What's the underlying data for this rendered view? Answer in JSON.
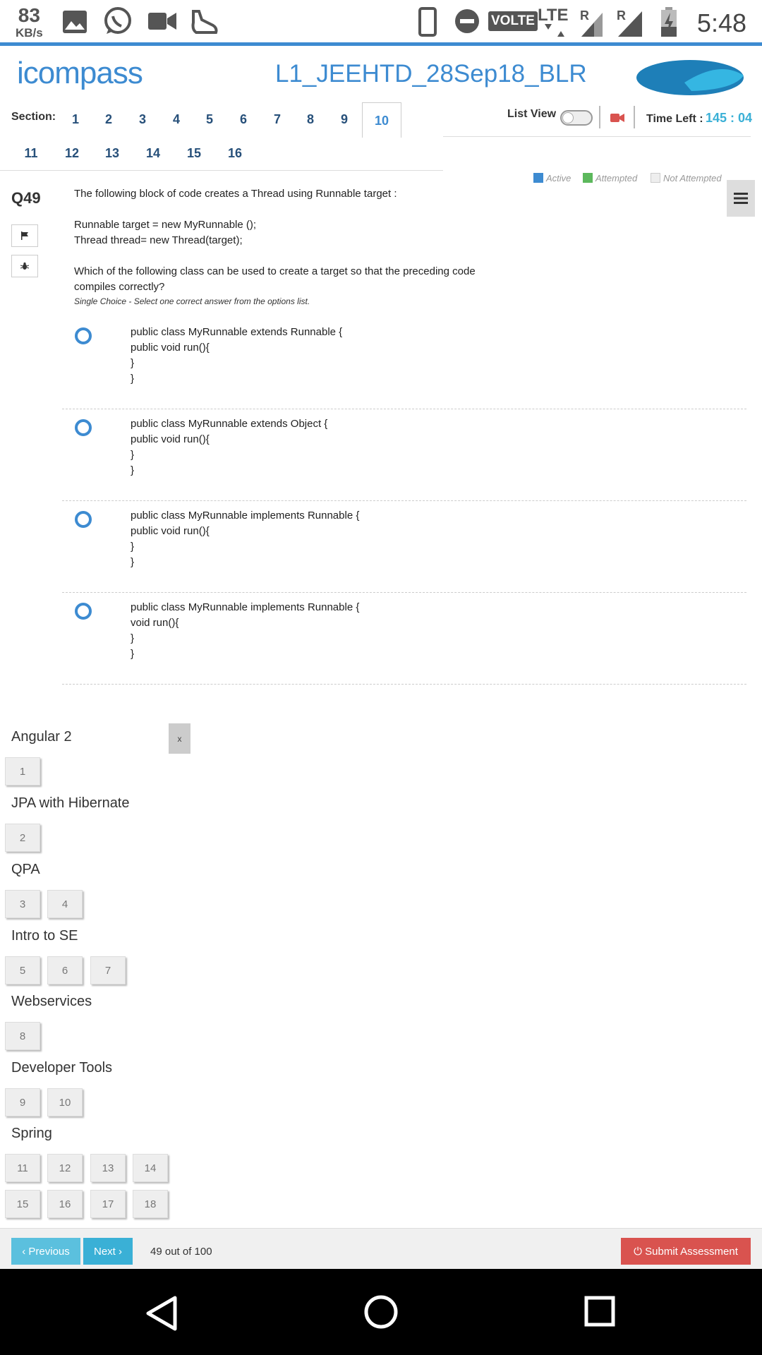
{
  "status_bar": {
    "speed_value": "83",
    "speed_unit": "KB/s",
    "volte": "VOLTE",
    "lte": "LTE",
    "roaming": "R",
    "time": "5:48"
  },
  "header": {
    "logo_text": "icompass",
    "title": "L1_JEEHTD_28Sep18_BLR"
  },
  "sections": {
    "label": "Section:",
    "tabs": [
      "1",
      "2",
      "3",
      "4",
      "5",
      "6",
      "7",
      "8",
      "9",
      "10",
      "11",
      "12",
      "13",
      "14",
      "15",
      "16"
    ],
    "active": "10"
  },
  "controls": {
    "list_view_label": "List View",
    "time_left_label": "Time Left :",
    "time_left_value": "145 : 04"
  },
  "legend": {
    "active": "Active",
    "attempted": "Attempted",
    "not_attempted": "Not Attempted"
  },
  "colors": {
    "active": "#3d8bd1",
    "attempted": "#5cb85c",
    "not_attempted": "#eeeeee",
    "submit": "#d9534f",
    "nav": "#5bc0de"
  },
  "question": {
    "number": "Q49",
    "lines": [
      "The following block of code creates a Thread using Runnable target :",
      "",
      "Runnable target = new MyRunnable ();",
      "Thread thread= new Thread(target);",
      "",
      "Which of the following class can be used to create a target so that the preceding code compiles correctly?"
    ],
    "hint": "Single Choice - Select one correct answer from the options list."
  },
  "options": [
    {
      "lines": [
        "public class MyRunnable extends Runnable {",
        "public void run(){",
        "}",
        "}"
      ]
    },
    {
      "lines": [
        "public class MyRunnable extends Object {",
        "public void run(){",
        "}",
        "}"
      ]
    },
    {
      "lines": [
        "public class MyRunnable implements Runnable {",
        "public void run(){",
        "}",
        "}"
      ]
    },
    {
      "lines": [
        "public class MyRunnable implements Runnable {",
        "void run(){",
        "}",
        "}"
      ]
    }
  ],
  "palette": {
    "close_label": "x",
    "groups": [
      {
        "title": "Angular 2",
        "questions": [
          "1"
        ]
      },
      {
        "title": "JPA with Hibernate",
        "questions": [
          "2"
        ]
      },
      {
        "title": "QPA",
        "questions": [
          "3",
          "4"
        ]
      },
      {
        "title": "Intro to SE",
        "questions": [
          "5",
          "6",
          "7"
        ]
      },
      {
        "title": "Webservices",
        "questions": [
          "8"
        ]
      },
      {
        "title": "Developer Tools",
        "questions": [
          "9",
          "10"
        ]
      },
      {
        "title": "Spring",
        "questions": [
          "11",
          "12",
          "13",
          "14",
          "15",
          "16",
          "17",
          "18"
        ]
      }
    ]
  },
  "footer": {
    "previous_label": "‹ Previous",
    "next_label": "Next ›",
    "progress": "49 out of 100",
    "submit_label": "⏻ Submit Assessment"
  }
}
